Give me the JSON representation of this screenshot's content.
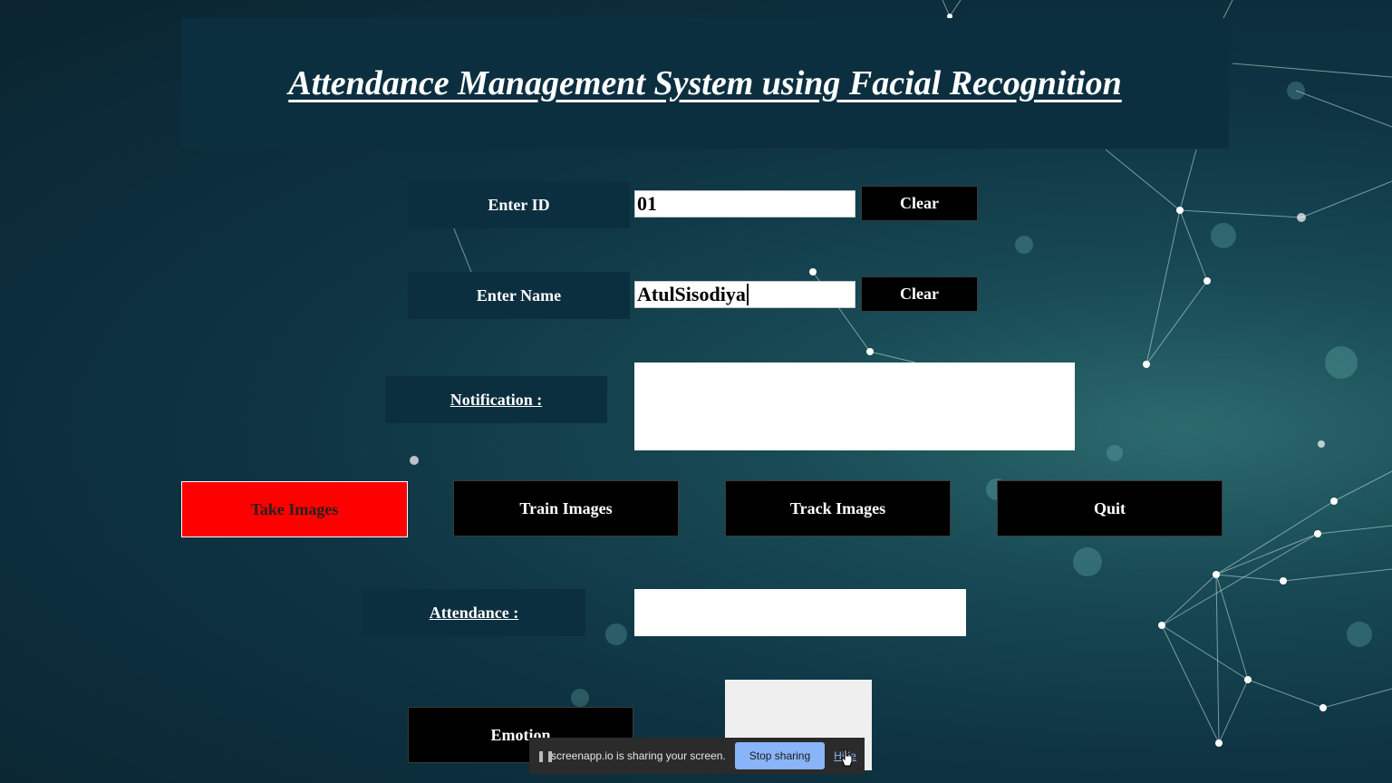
{
  "title": "Attendance Management System using Facial Recognition",
  "form": {
    "id_label": "Enter ID",
    "id_value": "01",
    "name_label": "Enter Name",
    "name_value": "AtulSisodiya",
    "clear_label": "Clear",
    "notification_label": "Notification :",
    "notification_value": "",
    "attendance_label": "Attendance :",
    "attendance_value": ""
  },
  "actions": {
    "take_images": "Take Images",
    "train_images": "Train Images",
    "track_images": "Track Images",
    "quit": "Quit",
    "emotion": "Emotion"
  },
  "share_bar": {
    "message": "screenapp.io is sharing your screen.",
    "stop": "Stop sharing",
    "hide": "Hide"
  },
  "colors": {
    "panel": "#0c2f40",
    "take_images_bg": "#ff0000",
    "button_bg": "#000000"
  }
}
